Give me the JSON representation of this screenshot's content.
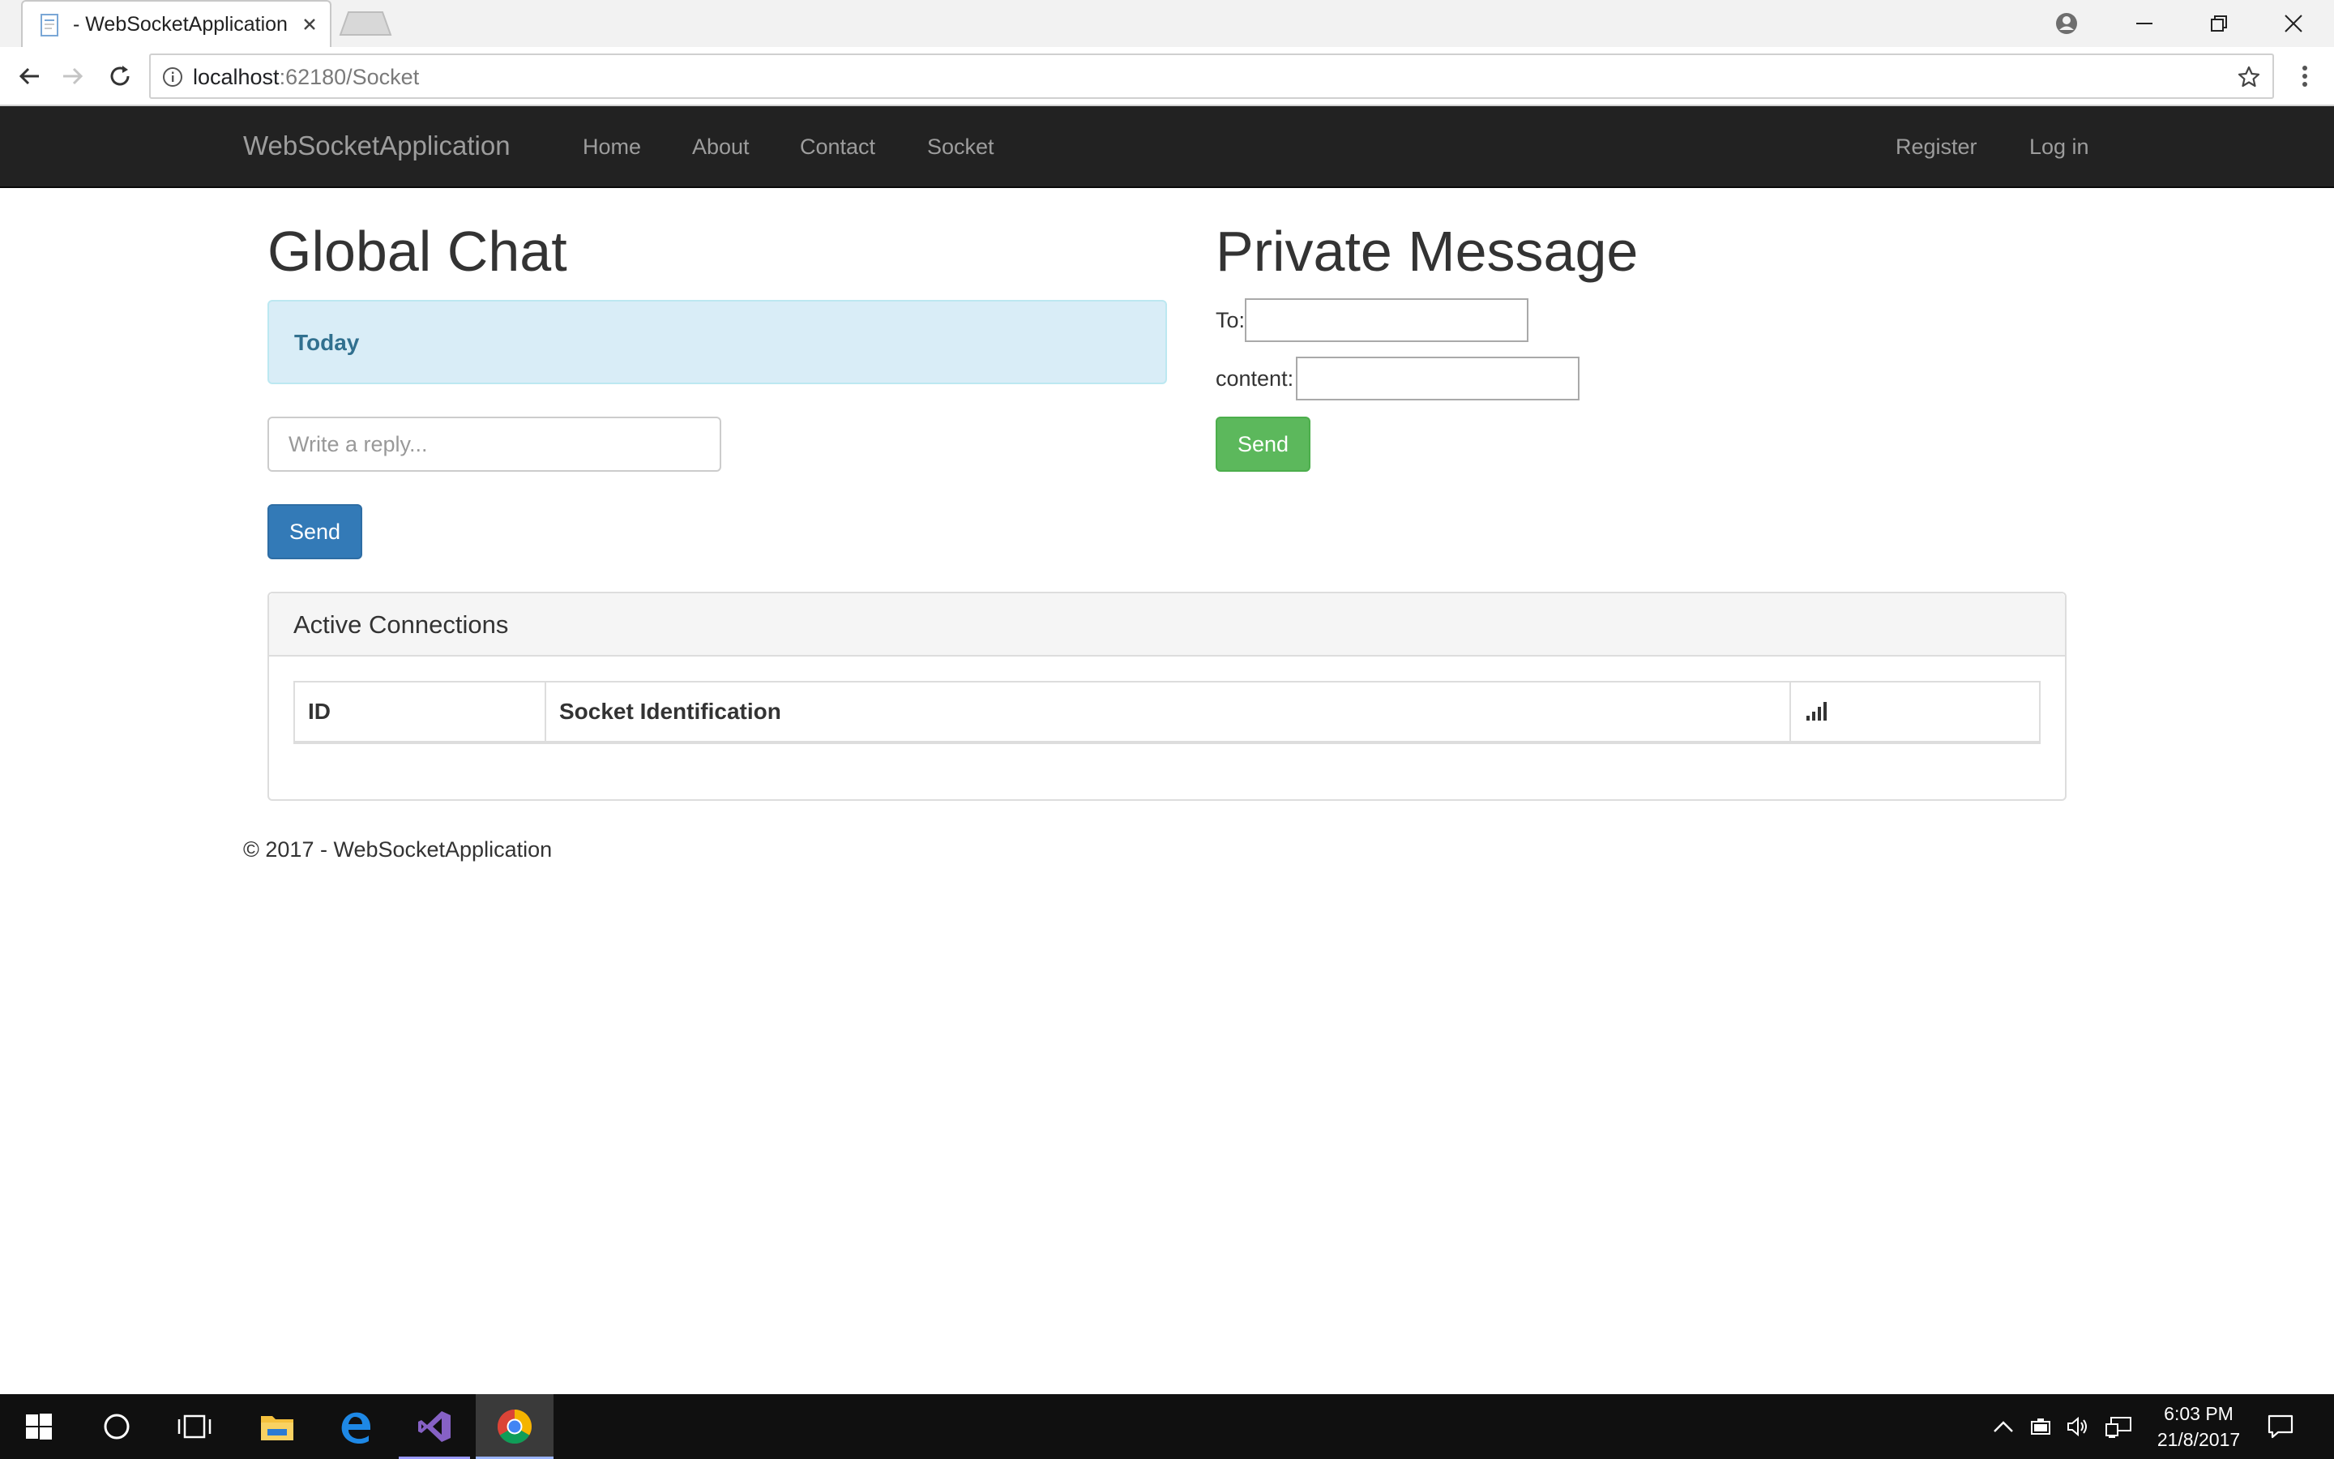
{
  "browser": {
    "tab_title": "- WebSocketApplication",
    "url_host": "localhost",
    "url_rest": ":62180/Socket",
    "icons": [
      "page-favicon-icon",
      "close-icon",
      "new-tab-icon",
      "account-icon",
      "minimize-icon",
      "restore-icon",
      "close-window-icon",
      "back-arrow-icon",
      "forward-arrow-icon",
      "reload-icon",
      "info-icon",
      "star-icon",
      "more-menu-icon"
    ]
  },
  "nav": {
    "brand": "WebSocketApplication",
    "links": [
      "Home",
      "About",
      "Contact",
      "Socket"
    ],
    "right_links": [
      "Register",
      "Log in"
    ]
  },
  "global_chat": {
    "title": "Global Chat",
    "today_label": "Today",
    "reply_placeholder": "Write a reply...",
    "send_label": "Send"
  },
  "private_message": {
    "title": "Private Message",
    "to_label": "To:",
    "content_label": "content:",
    "send_label": "Send"
  },
  "connections": {
    "title": "Active Connections",
    "columns": [
      "ID",
      "Socket Identification"
    ],
    "signal_column_icon": "signal-bars-icon",
    "rows": []
  },
  "footer": {
    "text": "© 2017 - WebSocketApplication"
  },
  "taskbar": {
    "apps": [
      "windows-start-icon",
      "cortana-icon",
      "task-view-icon",
      "file-explorer-icon",
      "edge-icon",
      "visual-studio-icon",
      "chrome-icon"
    ],
    "tray_icons": [
      "chevron-up-icon",
      "battery-icon",
      "volume-icon",
      "network-icon",
      "action-center-icon"
    ],
    "time": "6:03 PM",
    "date": "21/8/2017"
  },
  "colors": {
    "navbar_bg": "#222222",
    "primary_button": "#337ab7",
    "success_button": "#5cb85c",
    "alert_info_bg": "#d9edf7",
    "alert_info_text": "#31708f"
  }
}
